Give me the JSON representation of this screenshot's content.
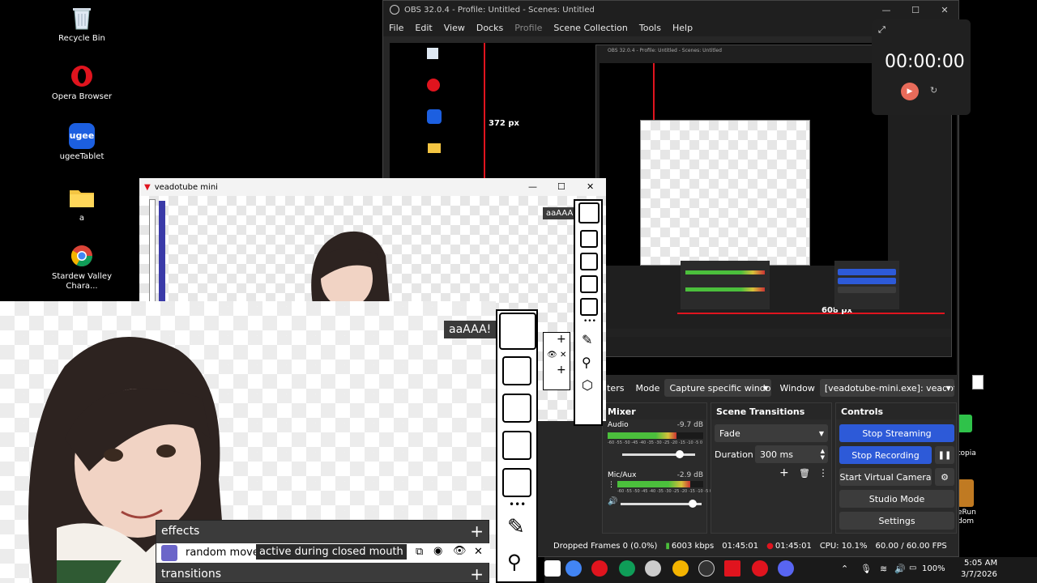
{
  "desktop": {
    "icons": [
      {
        "label": "Recycle Bin",
        "icon": "recycle-bin-icon"
      },
      {
        "label": "Opera Browser",
        "icon": "opera-icon"
      },
      {
        "label": "ugeeTablet",
        "icon": "ugee-icon"
      },
      {
        "label": "a",
        "icon": "folder-icon"
      },
      {
        "label": "Stardew Valley Chara...",
        "icon": "chrome-icon"
      }
    ],
    "right_icons": [
      {
        "label": "topia"
      },
      {
        "label": "eRun dom"
      }
    ]
  },
  "obs": {
    "title": "OBS 32.0.4 - Profile: Untitled - Scenes: Untitled",
    "menu": [
      "File",
      "Edit",
      "View",
      "Docks",
      "Profile",
      "Scene Collection",
      "Tools",
      "Help"
    ],
    "preview": {
      "width_label": "372 px",
      "height_label": "608 px",
      "inner_title": "OBS 32.0.4 - Profile: Untitled - Scenes: Untitled"
    },
    "source_bar": {
      "filters_label": "ilters",
      "mode_label": "Mode",
      "mode_value": "Capture specific windo",
      "window_label": "Window",
      "window_value": "[veadotube-mini.exe]: veadotul"
    },
    "mixer": {
      "title": "Mixer",
      "channels": [
        {
          "name": "Audio",
          "db": "-9.7 dB",
          "level": 0.72
        },
        {
          "name": "Mic/Aux",
          "db": "-2.9 dB",
          "level": 0.85
        }
      ],
      "scale": "-60 -55 -50 -45 -40 -35 -30 -25 -20 -15 -10 -5 0"
    },
    "transitions": {
      "title": "Scene Transitions",
      "type": "Fade",
      "duration_label": "Duration",
      "duration_value": "300 ms"
    },
    "controls": {
      "title": "Controls",
      "stop_streaming": "Stop Streaming",
      "stop_recording": "Stop Recording",
      "virtual_camera": "Start Virtual Camera",
      "studio_mode": "Studio Mode",
      "settings": "Settings"
    },
    "status": {
      "dropped": "Dropped Frames 0 (0.0%)",
      "bitrate": "6003 kbps",
      "stream_time": "01:45:01",
      "rec_time": "01:45:01",
      "cpu": "CPU: 10.1%",
      "fps": "60.00 / 60.00 FPS"
    }
  },
  "timer": {
    "time": "00:00:00"
  },
  "veado": {
    "title": "veadotube mini",
    "speech": "aaAAA!",
    "menu_effects": "effects",
    "effect_item": "random move",
    "tooltip": "active during closed mouth",
    "menu_transitions": "transitions"
  },
  "taskbar": {
    "time": "5:05 AM",
    "date": "3/7/2026",
    "battery": "100%"
  },
  "colors": {
    "obs_blue": "#2d5ad8",
    "guide_red": "#e0141e",
    "veado_blue": "#3a3aa8",
    "meter_green": "#4bbf3c"
  }
}
